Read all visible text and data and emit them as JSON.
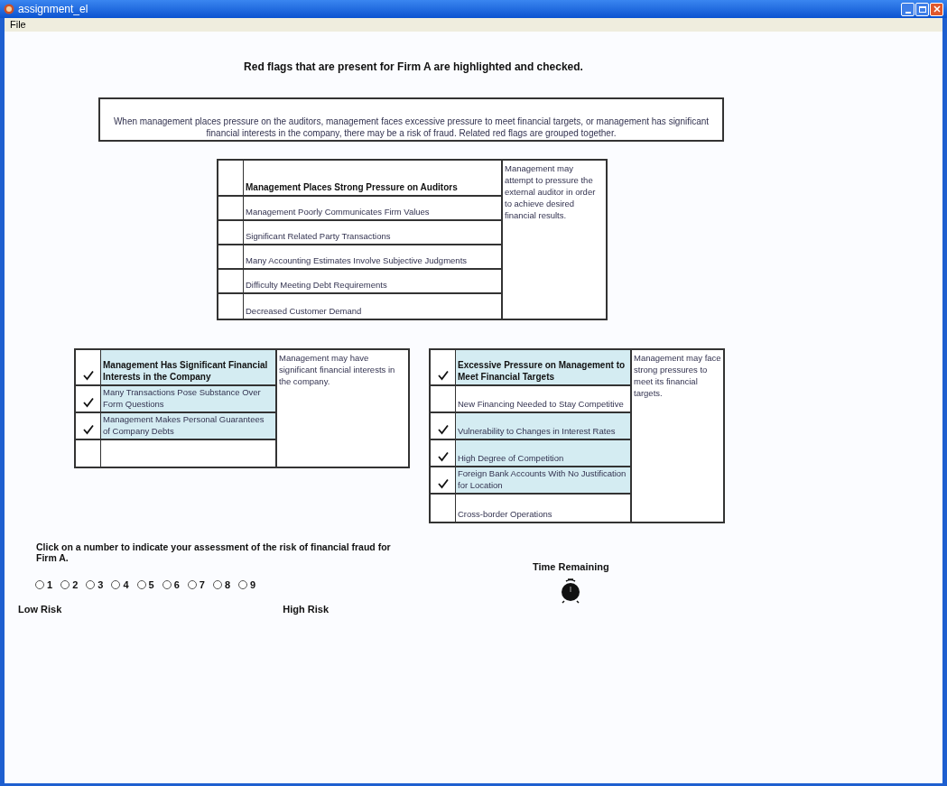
{
  "window": {
    "title": "assignment_el"
  },
  "menu": [
    "File"
  ],
  "heading": "Red flags that are present for Firm A are highlighted and checked.",
  "intro": "When management places pressure on the auditors, management faces excessive pressure to meet financial targets, or management has significant financial interests in the company, there may be a risk of fraud.  Related red flags are grouped together.",
  "groups": [
    {
      "header": {
        "label": "Management Places Strong Pressure on Auditors",
        "checked": false
      },
      "description": "Management may attempt to pressure the external auditor in order to achieve desired financial results.",
      "items": [
        {
          "label": "Management Poorly Communicates Firm Values",
          "checked": false
        },
        {
          "label": "Significant Related Party Transactions",
          "checked": false
        },
        {
          "label": "Many Accounting Estimates Involve Subjective Judgments",
          "checked": false
        },
        {
          "label": "Difficulty Meeting Debt Requirements",
          "checked": false
        },
        {
          "label": "Decreased Customer Demand",
          "checked": false
        }
      ]
    },
    {
      "header": {
        "label": "Management Has Significant Financial Interests in the Company",
        "checked": true
      },
      "description": "Management may have significant financial interests in the company.",
      "items": [
        {
          "label": "Many Transactions Pose Substance Over Form Questions",
          "checked": true
        },
        {
          "label": "Management Makes Personal Guarantees of Company Debts",
          "checked": true
        }
      ]
    },
    {
      "header": {
        "label": "Excessive Pressure on Management to Meet Financial Targets",
        "checked": true
      },
      "description": "Management may face strong pressures to meet its financial targets.",
      "items": [
        {
          "label": "New Financing Needed to Stay Competitive",
          "checked": false
        },
        {
          "label": "Vulnerability to Changes in Interest Rates",
          "checked": true
        },
        {
          "label": "High Degree of Competition",
          "checked": true
        },
        {
          "label": "Foreign Bank Accounts With No Justification for Location",
          "checked": true
        },
        {
          "label": "Cross-border Operations",
          "checked": false
        }
      ]
    }
  ],
  "assessment": {
    "prompt": "Click on a number to indicate your assessment of the risk of financial fraud for Firm A.",
    "options": [
      {
        "label": "1",
        "selected": false
      },
      {
        "label": "2",
        "selected": false
      },
      {
        "label": "3",
        "selected": false
      },
      {
        "label": "4",
        "selected": false
      },
      {
        "label": "5",
        "selected": false
      },
      {
        "label": "6",
        "selected": false
      },
      {
        "label": "7",
        "selected": false
      },
      {
        "label": "8",
        "selected": false
      },
      {
        "label": "9",
        "selected": false
      }
    ],
    "low_label": "Low Risk",
    "high_label": "High Risk"
  },
  "timer": {
    "label": "Time Remaining"
  }
}
